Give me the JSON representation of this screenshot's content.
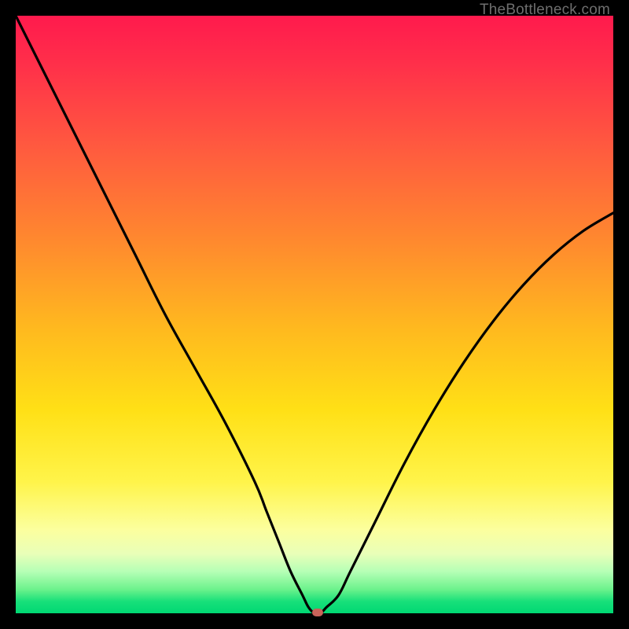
{
  "watermark": "TheBottleneck.com",
  "chart_data": {
    "type": "line",
    "title": "",
    "xlabel": "",
    "ylabel": "",
    "xlim": [
      0,
      100
    ],
    "ylim": [
      0,
      100
    ],
    "grid": false,
    "series": [
      {
        "name": "bottleneck-curve",
        "x": [
          0,
          5,
          10,
          15,
          20,
          25,
          30,
          35,
          40,
          42,
          44,
          46,
          48,
          49,
          50,
          51,
          52,
          54,
          56,
          60,
          65,
          70,
          75,
          80,
          85,
          90,
          95,
          100
        ],
        "y": [
          100,
          90,
          80,
          70,
          60,
          50,
          41,
          32,
          22,
          17,
          12,
          7,
          3,
          1,
          0,
          0,
          1,
          3,
          7,
          15,
          25,
          34,
          42,
          49,
          55,
          60,
          64,
          67
        ]
      }
    ],
    "marker": {
      "x": 50.5,
      "y": 0,
      "color": "#c9635a"
    },
    "gradient_stops": [
      {
        "pos": 0,
        "color": "#ff1a4d"
      },
      {
        "pos": 50,
        "color": "#ffb81f"
      },
      {
        "pos": 78,
        "color": "#fff44a"
      },
      {
        "pos": 100,
        "color": "#00d873"
      }
    ]
  }
}
